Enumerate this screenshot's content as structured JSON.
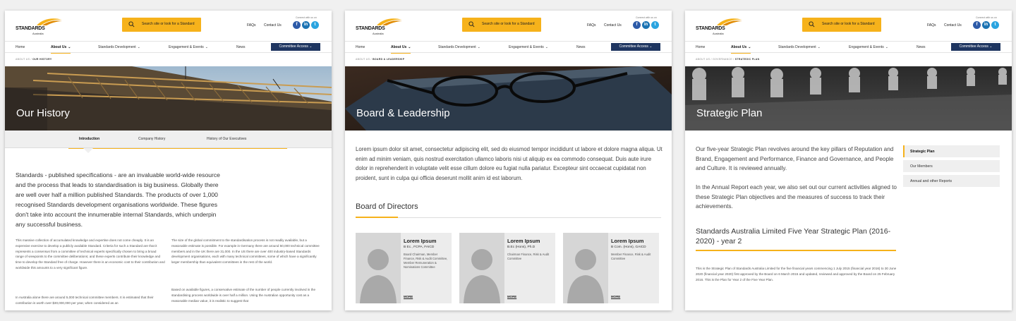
{
  "header": {
    "logo_name": "STANDARDS",
    "logo_sub": "Australia",
    "search_label": "Search site or look for a Standard",
    "faqs": "FAQs",
    "contact": "Contact Us",
    "connect": "Connect with us on",
    "social": [
      "f",
      "in",
      "t"
    ]
  },
  "nav": {
    "home": "Home",
    "about": "About Us",
    "standards_dev": "Standards Development",
    "engagement": "Engagement & Events",
    "news": "News",
    "committee": "Committee Access"
  },
  "colors": {
    "accent": "#f6b21b",
    "navy": "#1e3560"
  },
  "page1": {
    "crumb_parent": "ABOUT US",
    "crumb_current": "OUR HISTORY",
    "title": "Our History",
    "tabs": [
      "Introduction",
      "Company History",
      "History of Our Executives"
    ],
    "lead": "Standards - published specifications - are an invaluable world-wide resource and the process that leads to standardisation is big business. Globally there are well over half a million published Standards. The products of over 1,000 recognised Standards development organisations worldwide. These figures don't take into account the innumerable internal Standards, which underpin any successful business.",
    "col1_p1": "This massive collection of accumulated knowledge and expertise does not come cheaply. It is an expensive exercise to develop a publicly available Standard. Criteria for such a Standard are that it represents a consensus from a committee of technical experts specifically chosen to bring a broad range of viewpoints to the committee deliberations; and these experts contribute their knowledge and time to develop the Standard free of charge. However there is an economic cost to their contribution and worldwide this amounts to a very significant figure.",
    "col1_p2": "In Australia alone there are around 5,000 technical committee members. It is estimated that their contribution is worth over $30,000,000 per year, when considered as an",
    "col2_p1": "The size of the global commitment to the standardisation process is not readily available, but a reasonable estimate is possible. For example in Germany there are around 50,000 technical committee members and in the UK there are 31,000. In the US there are over 400 industry-based Standards development organisations, each with many technical committees, some of which have a significantly larger membership than equivalent committees in the rest of the world.",
    "col2_p2": "Based on available figures, a conservative estimate of the number of people currently involved in the standardising process worldwide is over half a million. Using the Australian opportunity cost as a reasonable median value, it is realistic to suggest that"
  },
  "page2": {
    "crumb_parent": "ABOUT US",
    "crumb_current": "BOARD & LEADERSHIP",
    "title": "Board & Leadership",
    "intro": "Lorem ipsum dolor sit amet, consectetur adipiscing elit, sed do eiusmod tempor incididunt ut labore et dolore magna aliqua. Ut enim ad minim veniam, quis nostrud exercitation ullamco laboris nisi ut aliquip ex ea commodo consequat. Duis aute irure dolor in reprehenderit in voluptate velit esse cillum dolore eu fugiat nulla pariatur. Excepteur sint occaecat cupidatat non proident, sunt in culpa qui officia deserunt mollit anim id est laborum.",
    "section": "Board of Directors",
    "cards": [
      {
        "name": "Lorem Ipsum",
        "qual": "B Ec., FCPA, FAICD",
        "role": "Board Chairman, Member Finance, Risk & Audit Committee, Member Remuneration & Nominations Committee",
        "more": "MORE"
      },
      {
        "name": "Lorem Ipsum",
        "qual": "B.Ec (Hons), Ph.D",
        "role": "Chairman Finance, Risk & Audit Committee",
        "more": "MORE"
      },
      {
        "name": "Lorem Ipsum",
        "qual": "B Com. (Hons), GAICD",
        "role": "Member Finance, Risk & Audit Committee",
        "more": "MORE"
      }
    ]
  },
  "page3": {
    "crumb_parent": "ABOUT US",
    "crumb_mid": "GOVERNANCE",
    "crumb_current": "STRATEGIC PLAN",
    "title": "Strategic Plan",
    "p1": "Our five-year Strategic Plan revolves around the key pillars of Reputation and Brand, Engagement and Performance, Finance and Governance, and People and Culture. It is reviewed annually.",
    "p2": "In the Annual Report each year, we also set out our current activities aligned to these Strategic Plan objectives and the measures of success to track their achievements.",
    "subtitle": "Standards Australia Limited Five Year Strategic Plan (2016-2020) - year 2",
    "small": "This is the Strategic Plan of Standards Australia Limited for the five financial years commencing 1 July 2015 (financial year 2016) to 30 June 2020 (financial year 2020) first approved by the Board on 6 March 2015 and updated, reviewed and approved by the Board on 25 February 2016. This is the Plan for Year 2 of the Five Year Plan.",
    "side": [
      "Strategic Plan",
      "Our Members",
      "Annual and other Reports"
    ]
  }
}
